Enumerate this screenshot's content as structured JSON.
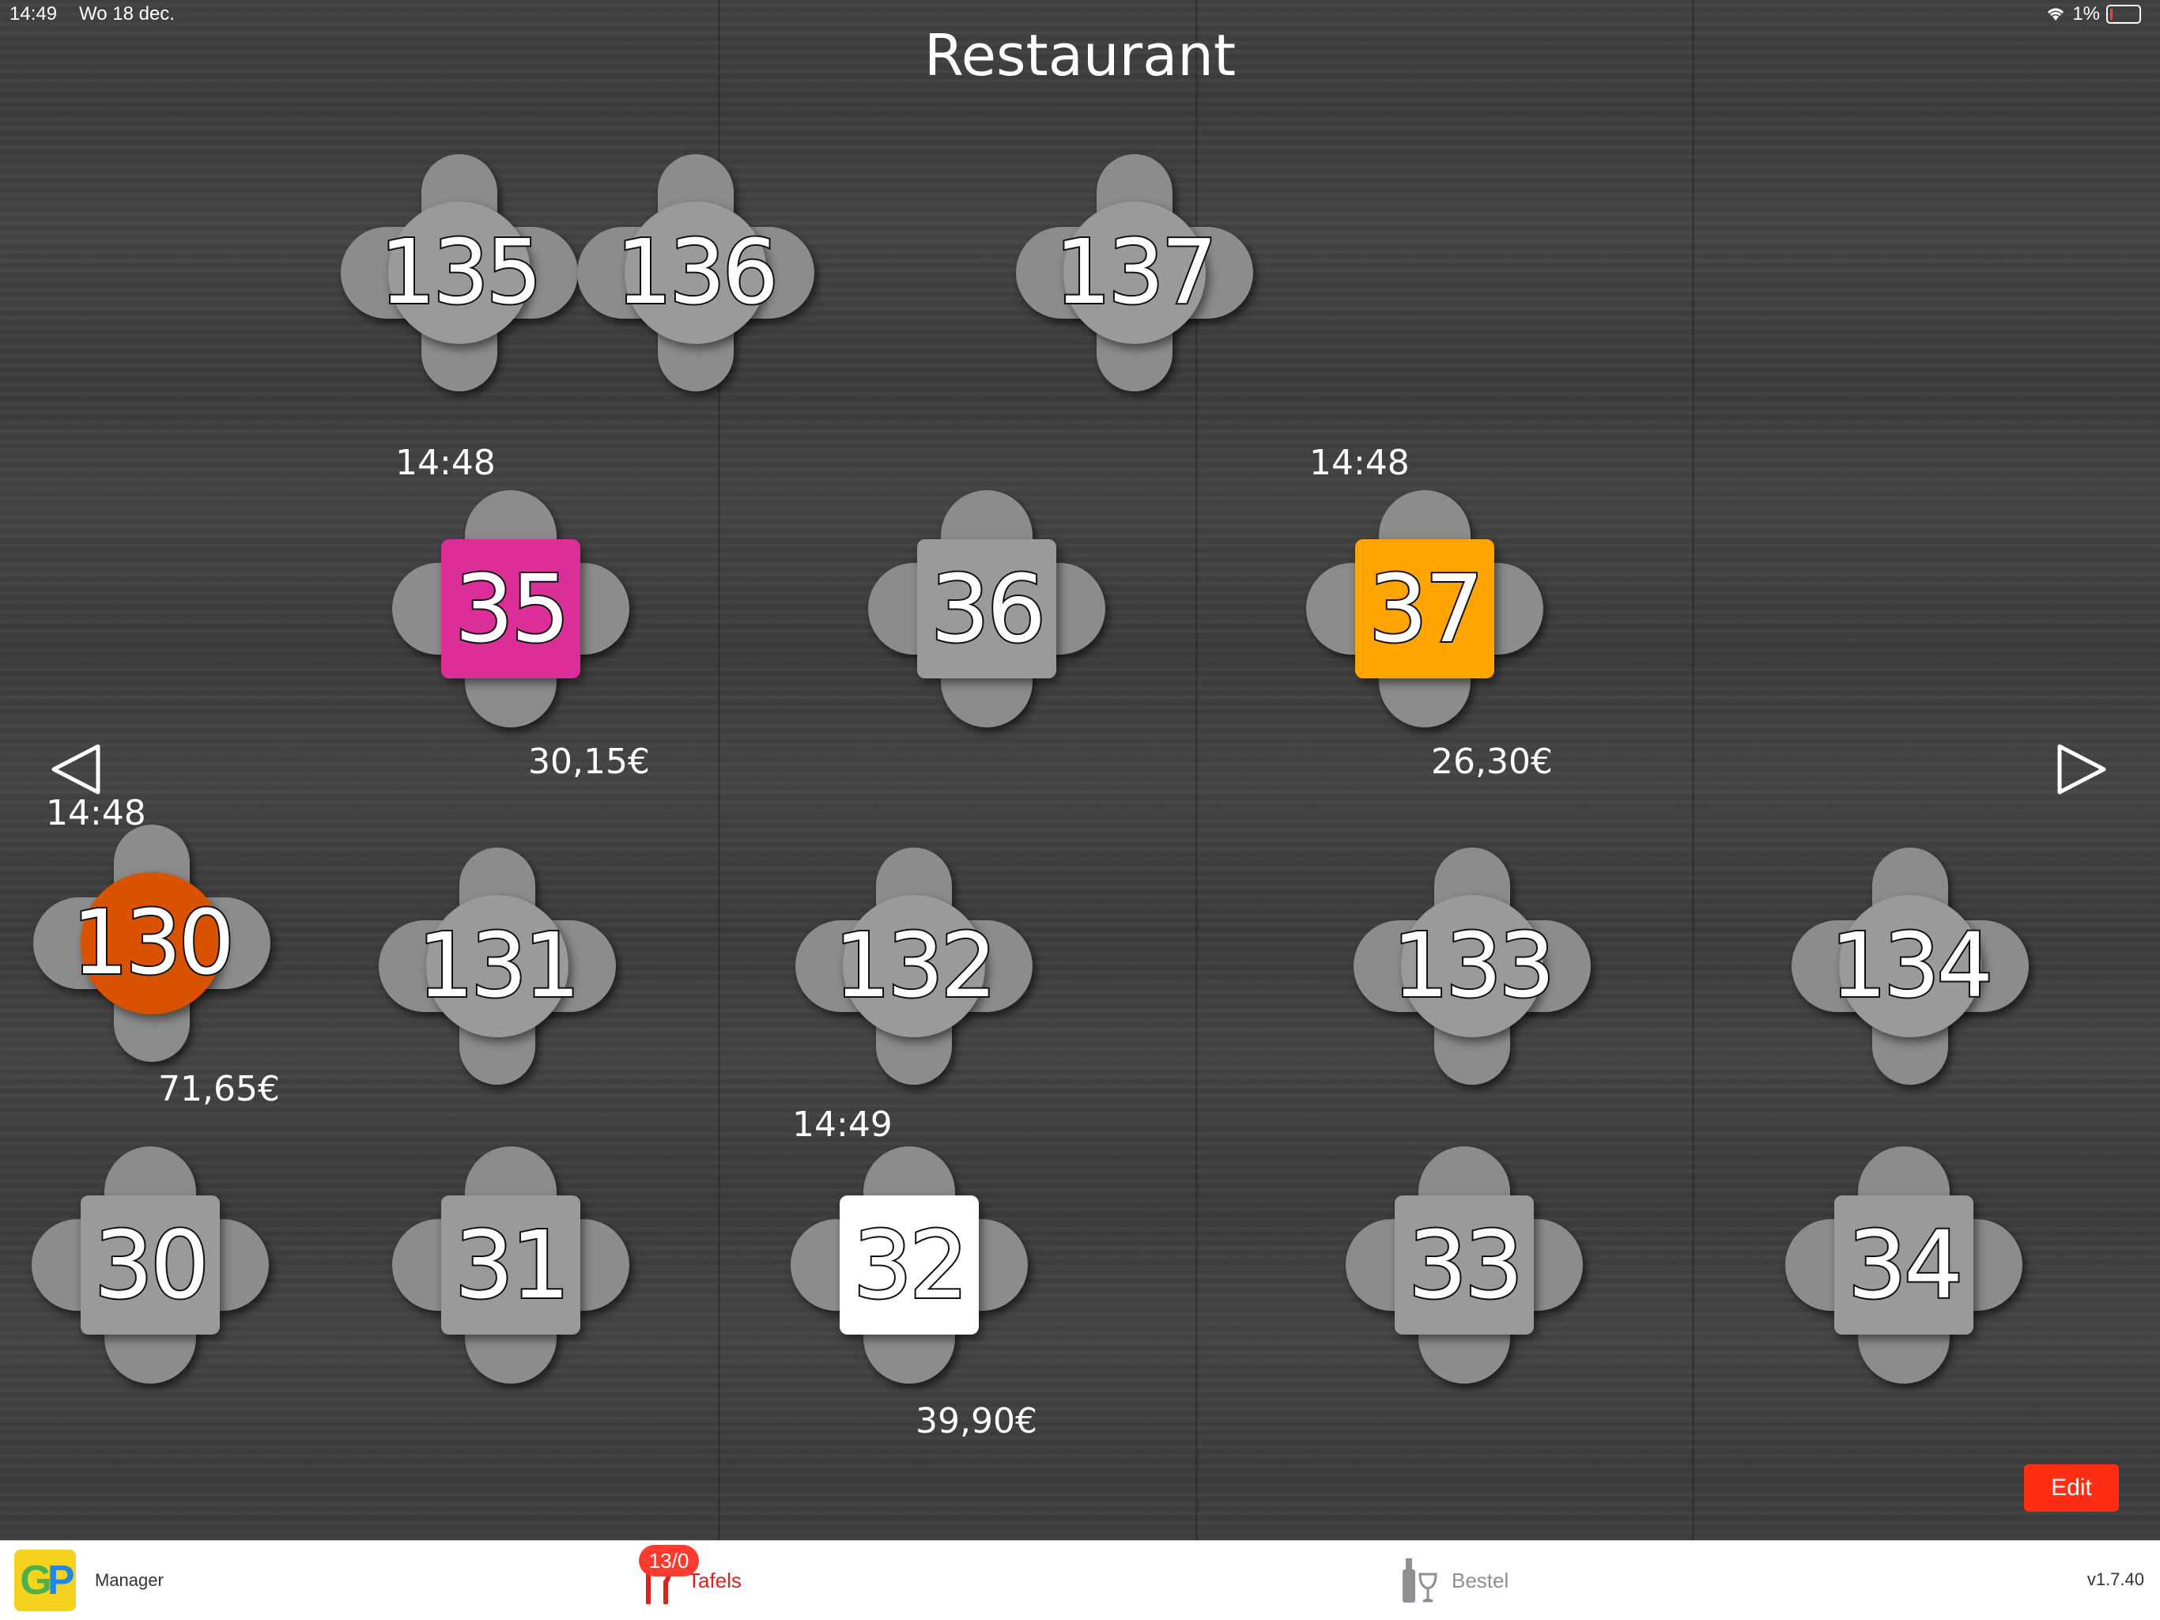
{
  "status_bar": {
    "time": "14:49",
    "date": "Wo 18 dec.",
    "battery": "1%"
  },
  "title": "Restaurant",
  "colors": {
    "chair": "#8c8c8c",
    "table_default": "#9a9a9a",
    "edit_button": "#ff2d14",
    "tab_active": "#e0201b",
    "tab_inactive": "#8e8e93"
  },
  "tables": [
    {
      "number": "135",
      "shape": "round",
      "color": "#9a9a9a"
    },
    {
      "number": "136",
      "shape": "round",
      "color": "#9a9a9a"
    },
    {
      "number": "137",
      "shape": "round",
      "color": "#9a9a9a"
    },
    {
      "number": "35",
      "shape": "square",
      "color": "#dc2e98",
      "time": "14:48",
      "amount": "30,15€"
    },
    {
      "number": "36",
      "shape": "square",
      "color": "#9a9a9a"
    },
    {
      "number": "37",
      "shape": "square",
      "color": "#ffa400",
      "time": "14:48",
      "amount": "26,30€"
    },
    {
      "number": "130",
      "shape": "round",
      "color": "#d85200",
      "time": "14:48",
      "amount": "71,65€"
    },
    {
      "number": "131",
      "shape": "round",
      "color": "#9a9a9a"
    },
    {
      "number": "132",
      "shape": "round",
      "color": "#9a9a9a"
    },
    {
      "number": "133",
      "shape": "round",
      "color": "#9a9a9a"
    },
    {
      "number": "134",
      "shape": "round",
      "color": "#9a9a9a"
    },
    {
      "number": "30",
      "shape": "square",
      "color": "#9a9a9a"
    },
    {
      "number": "31",
      "shape": "square",
      "color": "#9a9a9a"
    },
    {
      "number": "32",
      "shape": "square",
      "color": "#ffffff",
      "time": "14:49",
      "amount": "39,90€"
    },
    {
      "number": "33",
      "shape": "square",
      "color": "#9a9a9a"
    },
    {
      "number": "34",
      "shape": "square",
      "color": "#9a9a9a"
    }
  ],
  "nav": {
    "prev_icon": "triangle-left-icon",
    "next_icon": "triangle-right-icon"
  },
  "edit_label": "Edit",
  "tabbar": {
    "manager": {
      "label": "Manager",
      "logo": "GP"
    },
    "tafels": {
      "label": "Tafels",
      "badge": "13/0",
      "icon": "fork-knife-icon"
    },
    "bestel": {
      "label": "Bestel",
      "icon": "bottle-glass-icon"
    },
    "version": "v1.7.40"
  }
}
